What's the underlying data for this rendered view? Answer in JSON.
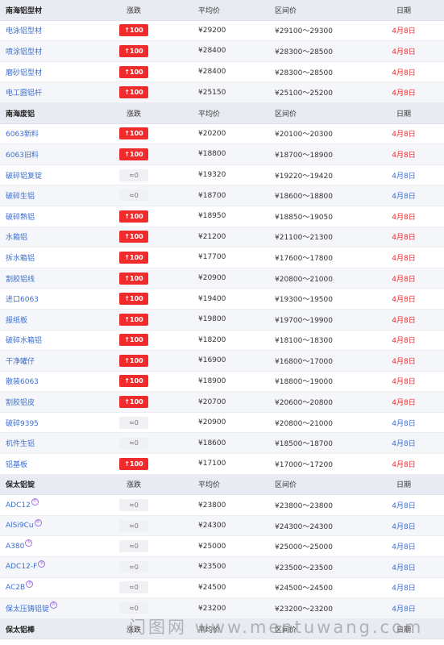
{
  "colors": {
    "up_red": "#ef2b2b",
    "link_blue": "#3b6fd0",
    "header_bg": "#e9ebf3"
  },
  "icons": {
    "up": "↑",
    "flat": "≈",
    "mark": "mark-circle-icon"
  },
  "sections": [
    {
      "header": {
        "name": "南海铝型材",
        "change": "涨跌",
        "avg": "平均价",
        "range": "区间价",
        "date": "日期"
      },
      "rows": [
        {
          "name": "电泳铝型材",
          "change": "↑100",
          "dir": "up",
          "avg": "¥29200",
          "range": "¥29100～29300",
          "date": "4月8日",
          "date_color": "red"
        },
        {
          "name": "喷涂铝型材",
          "change": "↑100",
          "dir": "up",
          "avg": "¥28400",
          "range": "¥28300～28500",
          "date": "4月8日",
          "date_color": "red"
        },
        {
          "name": "磨砂铝型材",
          "change": "↑100",
          "dir": "up",
          "avg": "¥28400",
          "range": "¥28300～28500",
          "date": "4月8日",
          "date_color": "red"
        },
        {
          "name": "电工圆铝杆",
          "change": "↑100",
          "dir": "up",
          "avg": "¥25150",
          "range": "¥25100～25200",
          "date": "4月8日",
          "date_color": "red"
        }
      ]
    },
    {
      "header": {
        "name": "南海废铝",
        "change": "涨跌",
        "avg": "平均价",
        "range": "区间价",
        "date": "日期"
      },
      "rows": [
        {
          "name": "6063新料",
          "change": "↑100",
          "dir": "up",
          "avg": "¥20200",
          "range": "¥20100～20300",
          "date": "4月8日",
          "date_color": "red"
        },
        {
          "name": "6063旧料",
          "change": "↑100",
          "dir": "up",
          "avg": "¥18800",
          "range": "¥18700～18900",
          "date": "4月8日",
          "date_color": "red"
        },
        {
          "name": "破碎铝复锭",
          "change": "≈0",
          "dir": "flat",
          "avg": "¥19320",
          "range": "¥19220～19420",
          "date": "4月8日",
          "date_color": "blue"
        },
        {
          "name": "破碎生铝",
          "change": "≈0",
          "dir": "flat",
          "avg": "¥18700",
          "range": "¥18600～18800",
          "date": "4月8日",
          "date_color": "blue"
        },
        {
          "name": "破碎熟铝",
          "change": "↑100",
          "dir": "up",
          "avg": "¥18950",
          "range": "¥18850～19050",
          "date": "4月8日",
          "date_color": "red"
        },
        {
          "name": "水箱铝",
          "change": "↑100",
          "dir": "up",
          "avg": "¥21200",
          "range": "¥21100～21300",
          "date": "4月8日",
          "date_color": "red"
        },
        {
          "name": "拆水箱铝",
          "change": "↑100",
          "dir": "up",
          "avg": "¥17700",
          "range": "¥17600～17800",
          "date": "4月8日",
          "date_color": "red"
        },
        {
          "name": "割胶铝线",
          "change": "↑100",
          "dir": "up",
          "avg": "¥20900",
          "range": "¥20800～21000",
          "date": "4月8日",
          "date_color": "red"
        },
        {
          "name": "进口6063",
          "change": "↑100",
          "dir": "up",
          "avg": "¥19400",
          "range": "¥19300～19500",
          "date": "4月8日",
          "date_color": "red"
        },
        {
          "name": "报纸板",
          "change": "↑100",
          "dir": "up",
          "avg": "¥19800",
          "range": "¥19700～19900",
          "date": "4月8日",
          "date_color": "red"
        },
        {
          "name": "破碎水箱铝",
          "change": "↑100",
          "dir": "up",
          "avg": "¥18200",
          "range": "¥18100～18300",
          "date": "4月8日",
          "date_color": "red"
        },
        {
          "name": "干净罐仔",
          "change": "↑100",
          "dir": "up",
          "avg": "¥16900",
          "range": "¥16800～17000",
          "date": "4月8日",
          "date_color": "red"
        },
        {
          "name": "散装6063",
          "change": "↑100",
          "dir": "up",
          "avg": "¥18900",
          "range": "¥18800～19000",
          "date": "4月8日",
          "date_color": "red"
        },
        {
          "name": "割胶铝皮",
          "change": "↑100",
          "dir": "up",
          "avg": "¥20700",
          "range": "¥20600～20800",
          "date": "4月8日",
          "date_color": "red"
        },
        {
          "name": "破碎9395",
          "change": "≈0",
          "dir": "flat",
          "avg": "¥20900",
          "range": "¥20800～21000",
          "date": "4月8日",
          "date_color": "blue"
        },
        {
          "name": "机件生铝",
          "change": "≈0",
          "dir": "flat",
          "avg": "¥18600",
          "range": "¥18500～18700",
          "date": "4月8日",
          "date_color": "blue"
        },
        {
          "name": "铝基板",
          "change": "↑100",
          "dir": "up",
          "avg": "¥17100",
          "range": "¥17000～17200",
          "date": "4月8日",
          "date_color": "red"
        }
      ]
    },
    {
      "header": {
        "name": "保太铝锭",
        "change": "涨跌",
        "avg": "平均价",
        "range": "区间价",
        "date": "日期"
      },
      "rows": [
        {
          "name": "ADC12",
          "mark": true,
          "change": "≈0",
          "dir": "flat",
          "avg": "¥23800",
          "range": "¥23800～23800",
          "date": "4月8日",
          "date_color": "blue"
        },
        {
          "name": "AlSi9Cu",
          "mark": true,
          "change": "≈0",
          "dir": "flat",
          "avg": "¥24300",
          "range": "¥24300～24300",
          "date": "4月8日",
          "date_color": "blue"
        },
        {
          "name": "A380",
          "mark": true,
          "change": "≈0",
          "dir": "flat",
          "avg": "¥25000",
          "range": "¥25000～25000",
          "date": "4月8日",
          "date_color": "blue"
        },
        {
          "name": "ADC12-F",
          "mark": true,
          "change": "≈0",
          "dir": "flat",
          "avg": "¥23500",
          "range": "¥23500～23500",
          "date": "4月8日",
          "date_color": "blue"
        },
        {
          "name": "AC2B",
          "mark": true,
          "change": "≈0",
          "dir": "flat",
          "avg": "¥24500",
          "range": "¥24500～24500",
          "date": "4月8日",
          "date_color": "blue"
        },
        {
          "name": "保太压铸铝锭",
          "mark": true,
          "change": "≈0",
          "dir": "flat",
          "avg": "¥23200",
          "range": "¥23200～23200",
          "date": "4月8日",
          "date_color": "blue"
        }
      ]
    },
    {
      "header": {
        "name": "保太铝棒",
        "change": "涨跌",
        "avg": "平均价",
        "range": "区间价",
        "date": "日期"
      },
      "rows": []
    }
  ],
  "watermark": "门图网 www.mentuwang.com"
}
